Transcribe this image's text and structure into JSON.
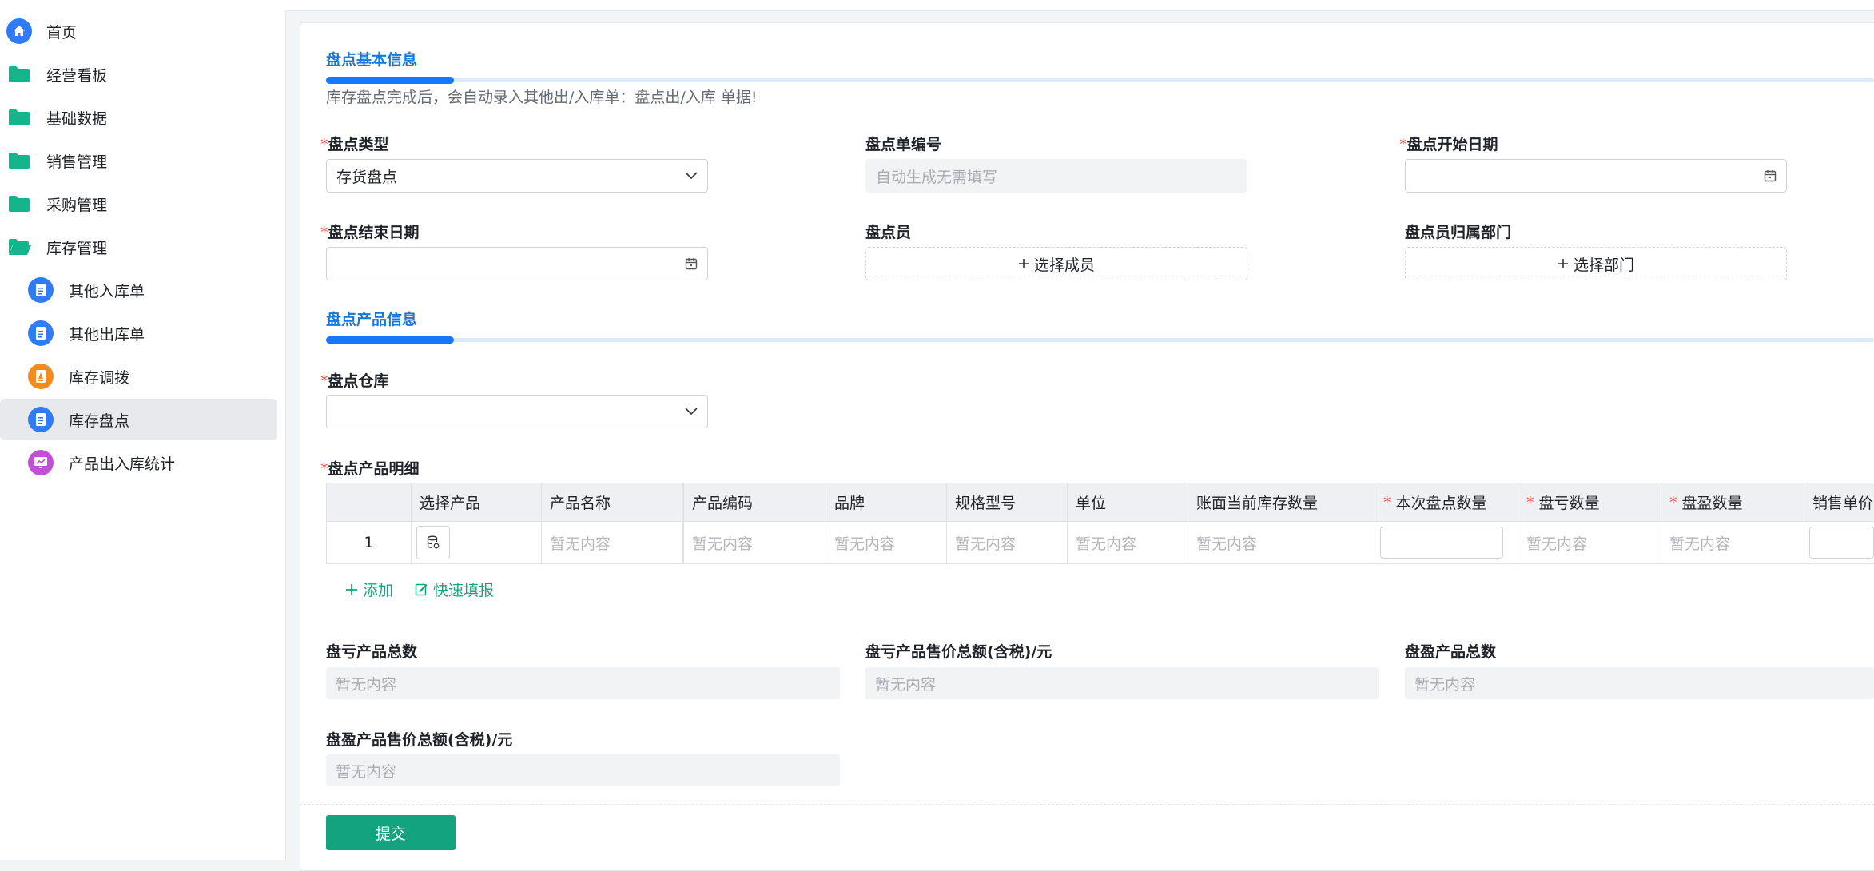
{
  "colors": {
    "accent_blue": "#1677ff",
    "accent_green": "#14a37f",
    "folder_teal": "#14b48c",
    "required": "#f54a45"
  },
  "sidebar": {
    "items": [
      {
        "label": "首页",
        "icon": "home-icon"
      },
      {
        "label": "经营看板",
        "icon": "folder-icon"
      },
      {
        "label": "基础数据",
        "icon": "folder-icon"
      },
      {
        "label": "销售管理",
        "icon": "folder-icon"
      },
      {
        "label": "采购管理",
        "icon": "folder-icon"
      },
      {
        "label": "库存管理",
        "icon": "folder-open-icon"
      },
      {
        "label": "其他入库单",
        "icon": "document-icon"
      },
      {
        "label": "其他出库单",
        "icon": "document-icon"
      },
      {
        "label": "库存调拨",
        "icon": "transfer-icon"
      },
      {
        "label": "库存盘点",
        "icon": "document-icon",
        "active": true
      },
      {
        "label": "产品出入库统计",
        "icon": "chart-icon"
      }
    ]
  },
  "form": {
    "basic_section": {
      "title": "盘点基本信息",
      "hint": "库存盘点完成后，会自动录入其他出/入库单：盘点出/入库 单据!"
    },
    "fields": {
      "type": {
        "label": "盘点类型",
        "required": "*",
        "value": "存货盘点"
      },
      "number": {
        "label": "盘点单编号",
        "placeholder": "自动生成无需填写"
      },
      "start_date": {
        "label": "盘点开始日期",
        "required": "*"
      },
      "end_date": {
        "label": "盘点结束日期",
        "required": "*"
      },
      "counter": {
        "label": "盘点员",
        "button": "选择成员"
      },
      "department": {
        "label": "盘点员归属部门",
        "button": "选择部门"
      },
      "warehouse": {
        "label": "盘点仓库",
        "required": "*"
      },
      "detail": {
        "label": "盘点产品明细",
        "required": "*"
      }
    },
    "product_section": {
      "title": "盘点产品信息"
    },
    "table": {
      "columns": [
        "选择产品",
        "产品名称",
        "产品编码",
        "品牌",
        "规格型号",
        "单位",
        "账面当前库存数量",
        "本次盘点数量",
        "盘亏数量",
        "盘盈数量",
        "销售单价("
      ],
      "required_mark": "*",
      "row": {
        "index": "1",
        "empty": "暂无内容"
      }
    },
    "actions": {
      "add": "添加",
      "quick_fill": "快速填报"
    },
    "totals": {
      "loss_count": {
        "label": "盘亏产品总数",
        "value": "暂无内容"
      },
      "loss_amount": {
        "label": "盘亏产品售价总额(含税)/元",
        "value": "暂无内容"
      },
      "gain_count": {
        "label": "盘盈产品总数",
        "value": "暂无内容"
      },
      "gain_amount": {
        "label": "盘盈产品售价总额(含税)/元",
        "value": "暂无内容"
      }
    },
    "submit": "提交"
  }
}
